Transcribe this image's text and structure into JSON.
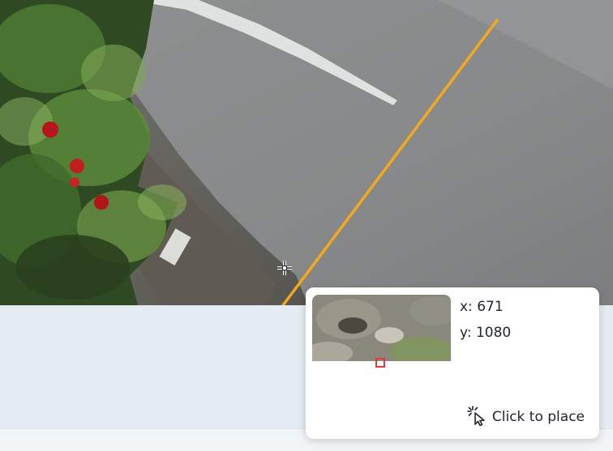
{
  "camera": {
    "line_color": "#f5a81c"
  },
  "cursor_icon": "crosshair-move-icon",
  "popover": {
    "preview_marker_color": "#e53935",
    "x_text": "x: 671",
    "y_text": "y: 1080",
    "action_label": "Click to place",
    "action_icon": "pointer-click-icon"
  }
}
